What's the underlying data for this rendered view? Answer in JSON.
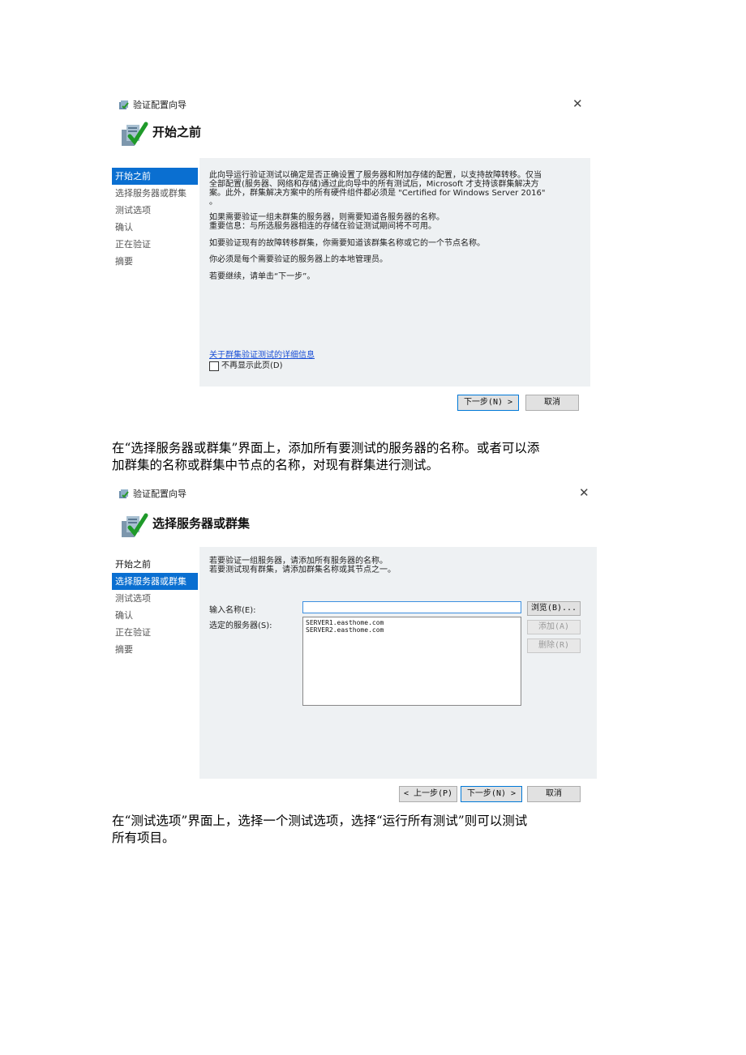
{
  "dialog1": {
    "window_title": "验证配置向导",
    "heading": "开始之前",
    "nav": [
      "开始之前",
      "选择服务器或群集",
      "测试选项",
      "确认",
      "正在验证",
      "摘要"
    ],
    "para1": [
      "此向导运行验证测试以确定是否正确设置了服务器和附加存储的配置，以支持故障转移。仅当",
      "全部配置(服务器、网络和存储)通过此向导中的所有测试后，Microsoft 才支持该群集解决方",
      "案。此外，群集解决方案中的所有硬件组件都必须是 \"Certified for Windows Server 2016\"",
      "。"
    ],
    "para2": [
      "如果需要验证一组未群集的服务器，则需要知道各服务器的名称。",
      "重要信息：与所选服务器相连的存储在验证测试期间将不可用。"
    ],
    "para3": "如要验证现有的故障转移群集，你需要知道该群集名称或它的一个节点名称。",
    "para4": "你必须是每个需要验证的服务器上的本地管理员。",
    "para5": "若要继续，请单击“下一步”。",
    "link": "关于群集验证测试的详细信息",
    "checkbox_label": "不再显示此页(D)",
    "next_button": "下一步(N) >",
    "cancel_button": "取消"
  },
  "text1": [
    "在“选择服务器或群集”界面上，添加所有要测试的服务器的名称。或者可以添",
    "加群集的名称或群集中节点的名称，对现有群集进行测试。"
  ],
  "dialog2": {
    "window_title": "验证配置向导",
    "heading": "选择服务器或群集",
    "nav": [
      "开始之前",
      "选择服务器或群集",
      "测试选项",
      "确认",
      "正在验证",
      "摘要"
    ],
    "intro": [
      "若要验证一组服务器，请添加所有服务器的名称。",
      "若要测试现有群集，请添加群集名称或其节点之一。"
    ],
    "name_label": "输入名称(E):",
    "name_value": "",
    "selected_label": "选定的服务器(S):",
    "servers": [
      "SERVER1.easthome.com",
      "SERVER2.easthome.com"
    ],
    "browse_button": "浏览(B)...",
    "add_button": "添加(A)",
    "remove_button": "删除(R)",
    "prev_button": "< 上一步(P)",
    "next_button": "下一步(N) >",
    "cancel_button": "取消"
  },
  "text2": [
    "在“测试选项”界面上，选择一个测试选项，选择“运行所有测试”则可以测试",
    "所有项目。"
  ],
  "icons": {
    "window": "cluster-window-icon",
    "wizard": "wizard-check-icon",
    "close": "close-icon"
  },
  "colors": {
    "accent": "#0a6fd1",
    "link": "#1a4fd6",
    "panel": "#eef1f3"
  }
}
